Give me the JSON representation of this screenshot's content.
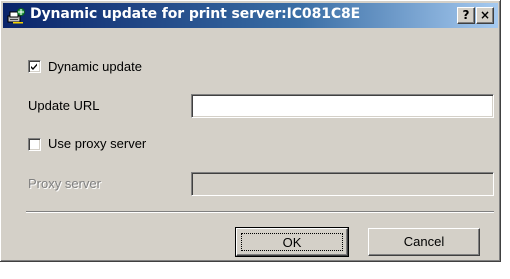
{
  "window": {
    "title": "Dynamic update for print server:IC081C8E",
    "help_glyph": "?",
    "close_glyph": "×"
  },
  "dynamic_update": {
    "label": "Dynamic update",
    "checked": true
  },
  "update_url": {
    "label": "Update URL",
    "value": ""
  },
  "use_proxy": {
    "label": "Use proxy server",
    "checked": false
  },
  "proxy_server": {
    "label": "Proxy server",
    "value": "",
    "enabled": false
  },
  "buttons": {
    "ok": "OK",
    "cancel": "Cancel"
  },
  "colors": {
    "titlebar_start": "#0a246a",
    "titlebar_end": "#a6caf0",
    "dialog_face": "#d4d0c8",
    "disabled_text": "#808080"
  },
  "icons": {
    "title": "printer-network-icon",
    "check": "checkmark-icon"
  }
}
